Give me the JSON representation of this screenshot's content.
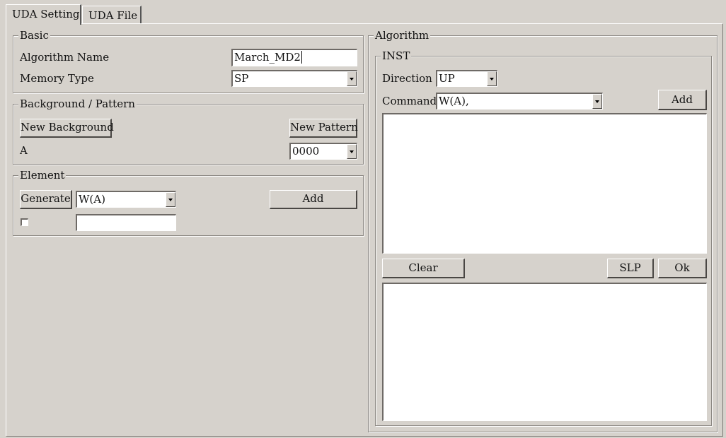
{
  "tabs": [
    {
      "label": "UDA Setting",
      "active": true
    },
    {
      "label": "UDA File",
      "active": false
    }
  ],
  "basic": {
    "legend": "Basic",
    "algorithm_name_label": "Algorithm Name",
    "algorithm_name_value": "March_MD2",
    "memory_type_label": "Memory Type",
    "memory_type_value": "SP"
  },
  "background_pattern": {
    "legend": "Background / Pattern",
    "new_background_label": "New Background",
    "new_pattern_label": "New Pattern",
    "a_label": "A",
    "a_value": "0000"
  },
  "element": {
    "legend": "Element",
    "generate_label": "Generate",
    "generate_value": "W(A)",
    "add_label": "Add",
    "checkbox_checked": false,
    "text_value": ""
  },
  "algorithm": {
    "legend": "Algorithm",
    "inst": {
      "legend": "INST",
      "direction_label": "Direction",
      "direction_value": "UP",
      "command_label": "Command",
      "command_value": "W(A),",
      "add_label": "Add",
      "clear_label": "Clear",
      "slp_label": "SLP",
      "ok_label": "Ok"
    }
  }
}
